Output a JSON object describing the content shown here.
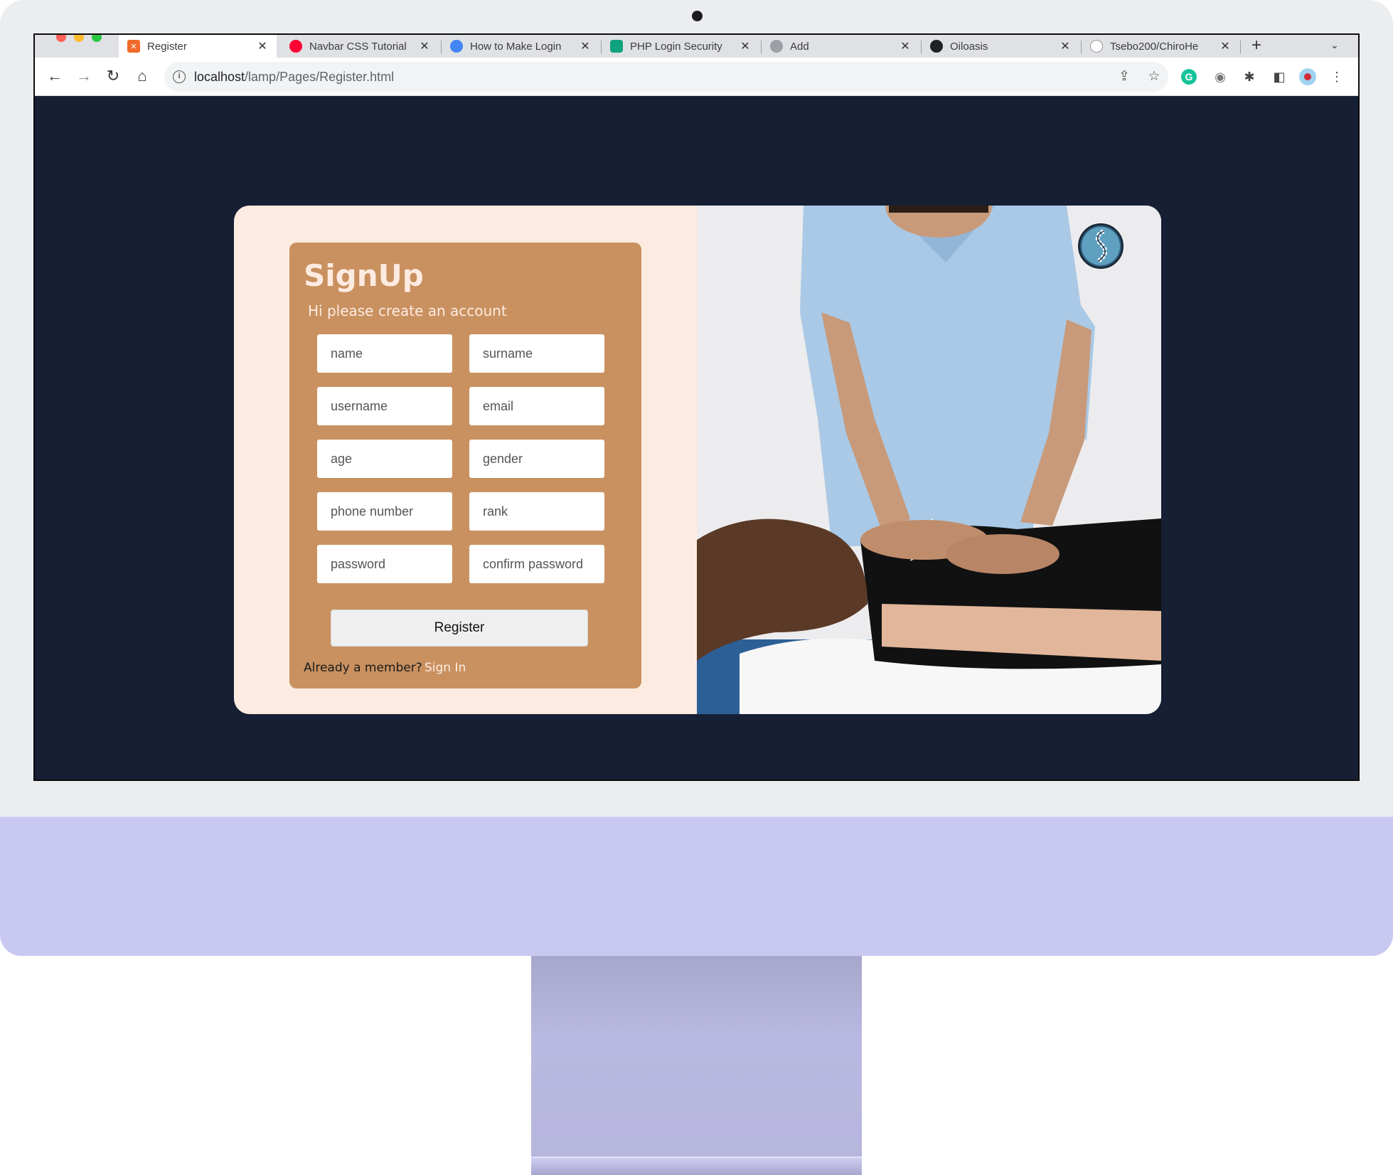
{
  "browser": {
    "tabs": [
      {
        "title": "Register",
        "close": "✕",
        "favicon_color": "#f26a2b",
        "active": true
      },
      {
        "title": "Navbar CSS Tutorial",
        "close": "✕",
        "favicon_color": "#ff0033"
      },
      {
        "title": "How to Make Login",
        "close": "✕",
        "favicon_color": "#4285f4"
      },
      {
        "title": "PHP Login Security",
        "close": "✕",
        "favicon_color": "#10a37f"
      },
      {
        "title": "Add",
        "close": "✕",
        "favicon_color": "#9aa0a6"
      },
      {
        "title": "Oiloasis",
        "close": "✕",
        "favicon_color": "#202124"
      },
      {
        "title": "Tsebo200/ChiroHe",
        "close": "✕",
        "favicon_color": "#ffffff"
      }
    ],
    "new_tab": "+",
    "tab_menu": "⌄",
    "nav": {
      "back": "←",
      "forward": "→",
      "reload": "↻",
      "home": "⌂"
    },
    "url_host": "localhost",
    "url_path": "/lamp/Pages/Register.html",
    "info": "i",
    "share": "⇪",
    "star": "☆",
    "grammarly": "G",
    "camera": "◉",
    "extensions": "✱",
    "sidepanel": "◧",
    "menu": "⋮"
  },
  "signup": {
    "title": "SignUp",
    "subtitle": "Hi please create an account",
    "fields": [
      {
        "placeholder": "name"
      },
      {
        "placeholder": "surname"
      },
      {
        "placeholder": "username"
      },
      {
        "placeholder": "email"
      },
      {
        "placeholder": "age"
      },
      {
        "placeholder": "gender"
      },
      {
        "placeholder": "phone number"
      },
      {
        "placeholder": "rank"
      },
      {
        "placeholder": "password"
      },
      {
        "placeholder": "confirm password"
      }
    ],
    "register_label": "Register",
    "already_member": "Already a member?",
    "signin_label": "Sign In"
  },
  "colors": {
    "page_bg": "#161f33",
    "card_bg": "#fdebe1",
    "form_bg": "#c99160",
    "accent_text": "#fdebe1",
    "scrubs": "#a9c9e6",
    "imac_chin": "#c9c8f1"
  },
  "photo": {
    "icon": "chiropractor-photo",
    "logo_icon": "spine-logo-icon"
  }
}
